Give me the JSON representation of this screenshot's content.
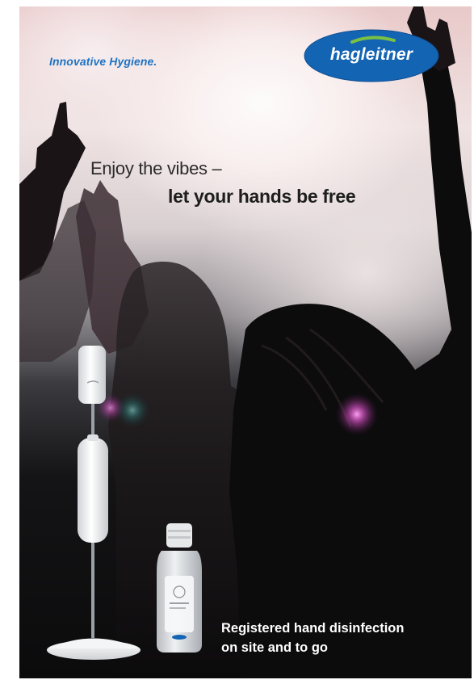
{
  "brand": {
    "tagline": "Innovative Hygiene.",
    "logo_text": "hagleitner",
    "logo_color": "#1464b4",
    "tagline_color": "#1f73c2"
  },
  "headline": {
    "line1": "Enjoy the vibes –",
    "line2": "let your hands be free"
  },
  "footer": {
    "line1": "Registered hand disinfection",
    "line2": "on site and to go"
  },
  "imagery": {
    "background": "concert-crowd-silhouettes",
    "products": [
      "hand-disinfectant-dispenser-stand",
      "hand-sanitizer-bottle"
    ]
  }
}
